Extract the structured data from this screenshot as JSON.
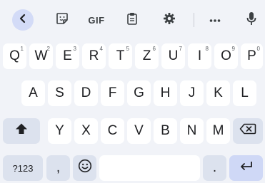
{
  "toolbar": {
    "gif_label": "GIF",
    "icons": [
      "back-arrow-icon",
      "sticker-icon",
      "gif-icon",
      "clipboard-icon",
      "gear-icon",
      "more-icon",
      "microphone-icon"
    ]
  },
  "rows": {
    "row1": [
      {
        "label": "Q",
        "hint": "1"
      },
      {
        "label": "W",
        "hint": "2"
      },
      {
        "label": "E",
        "hint": "3"
      },
      {
        "label": "R",
        "hint": "4"
      },
      {
        "label": "T",
        "hint": "5"
      },
      {
        "label": "Z",
        "hint": "6"
      },
      {
        "label": "U",
        "hint": "7"
      },
      {
        "label": "I",
        "hint": "8"
      },
      {
        "label": "O",
        "hint": "9"
      },
      {
        "label": "P",
        "hint": "0"
      }
    ],
    "row2": [
      "A",
      "S",
      "D",
      "F",
      "G",
      "H",
      "J",
      "K",
      "L"
    ],
    "row3": [
      "Y",
      "X",
      "C",
      "V",
      "B",
      "N",
      "M"
    ],
    "row4": {
      "symbols_label": "?123",
      "comma_label": ",",
      "period_label": "."
    }
  },
  "colors": {
    "keyboard_bg": "#f1f3f8",
    "key_bg": "#ffffff",
    "func_key_bg": "#dce2ee",
    "accent": "#cfd8f6"
  }
}
